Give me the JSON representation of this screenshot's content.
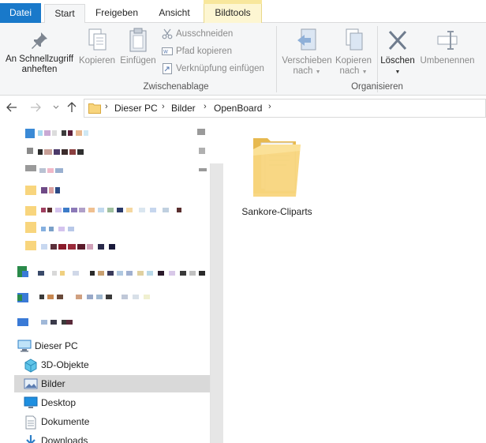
{
  "tabs": {
    "file": "Datei",
    "start": "Start",
    "share": "Freigeben",
    "view": "Ansicht",
    "context": "Bildtools"
  },
  "ribbon": {
    "pin": {
      "line1": "An Schnellzugriff",
      "line2": "anheften",
      "icon": "pin-icon"
    },
    "copy": {
      "label": "Kopieren",
      "icon": "copy-icon"
    },
    "paste": {
      "label": "Einfügen",
      "icon": "clipboard-icon"
    },
    "cut": {
      "label": "Ausschneiden",
      "icon": "scissors-icon"
    },
    "copy_path": {
      "label": "Pfad kopieren",
      "icon": "path-icon"
    },
    "paste_shortcut": {
      "label": "Verknüpfung einfügen",
      "icon": "shortcut-icon"
    },
    "group_clipboard": "Zwischenablage",
    "move_to": {
      "line1": "Verschieben",
      "line2": "nach",
      "icon": "move-to-icon"
    },
    "copy_to": {
      "line1": "Kopieren",
      "line2": "nach",
      "icon": "copy-to-icon"
    },
    "delete": {
      "label": "Löschen",
      "icon": "delete-x-icon"
    },
    "rename": {
      "label": "Umbenennen",
      "icon": "rename-icon"
    },
    "group_organize": "Organisieren"
  },
  "address": {
    "path": [
      "Dieser PC",
      "Bilder",
      "OpenBoard"
    ]
  },
  "nav": {
    "this_pc": "Dieser PC",
    "items": [
      {
        "label": "3D-Objekte",
        "icon": "3d-objects-icon"
      },
      {
        "label": "Bilder",
        "icon": "pictures-icon",
        "selected": true
      },
      {
        "label": "Desktop",
        "icon": "desktop-icon"
      },
      {
        "label": "Dokumente",
        "icon": "documents-icon"
      },
      {
        "label": "Downloads",
        "icon": "downloads-icon"
      }
    ]
  },
  "content": {
    "items": [
      {
        "name": "Sankore-Cliparts",
        "icon": "folder-icon"
      }
    ]
  },
  "colors": {
    "file_tab": "#1979ca",
    "ribbon_bg": "#f5f6f7",
    "context_tab": "#fdf6d2",
    "selection": "#d9d9d9",
    "folder": "#f5c96a"
  }
}
